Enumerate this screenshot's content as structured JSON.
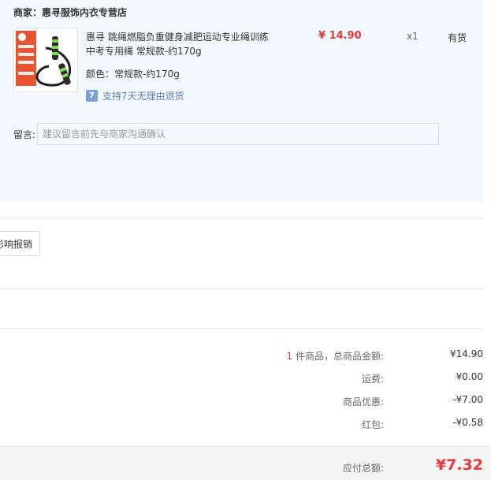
{
  "shop": {
    "name": "商家：惠寻服饰内衣专营店"
  },
  "item": {
    "title": "惠寻 跳绳燃脂负重健身减肥运动专业绳训练中考专用绳 常规款-约170g",
    "price": "¥ 14.90",
    "qty": "x1",
    "stock": "有货",
    "color_label": "颜色：",
    "color_value": "常规款-约170g",
    "return_badge": "7",
    "return_text": "支持7天无理由退货"
  },
  "memo": {
    "label": "留言:",
    "placeholder": "建议留言前先与商家沟通确认"
  },
  "claim_button": "影响报销",
  "summary": {
    "count": "1",
    "count_suffix": " 件商品，总商品金额:",
    "goods_amount": "¥14.90",
    "shipping_label": "运费:",
    "shipping": "¥0.00",
    "discount_label": "商品优惠:",
    "discount": "-¥7.00",
    "redpacket_label": "红包:",
    "redpacket": "-¥0.58"
  },
  "total": {
    "label": "应付总额:",
    "value": "¥7.32"
  },
  "colors": {
    "price_red": "#e4393c",
    "panel_bg": "#f3f8fe",
    "link_blue": "#5c7fb8"
  }
}
